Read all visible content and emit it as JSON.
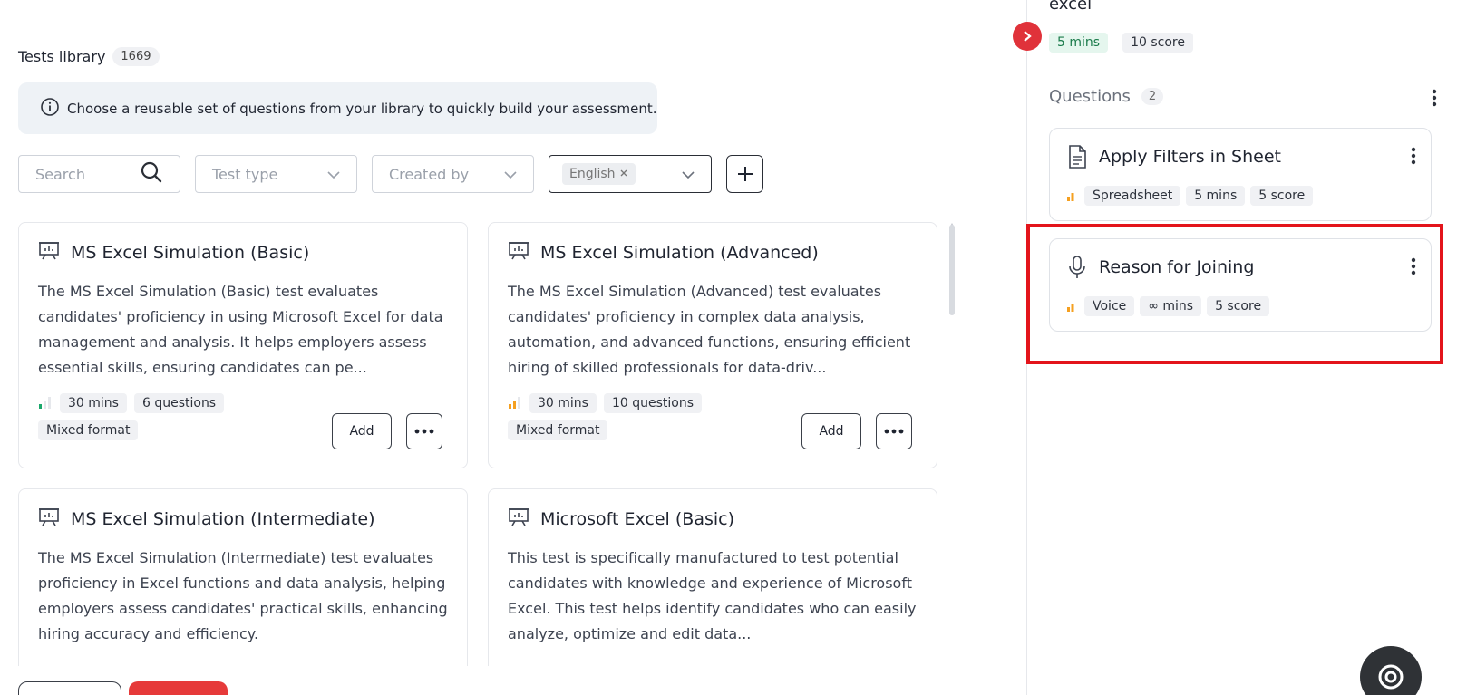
{
  "library": {
    "title": "Tests library",
    "count": "1669",
    "info": "Choose a reusable set of questions from your library to quickly build your assessment."
  },
  "filters": {
    "search_placeholder": "Search",
    "test_type": "Test type",
    "created_by": "Created by",
    "language_chip": "English"
  },
  "cards": [
    {
      "title": "MS Excel Simulation (Basic)",
      "description": "The MS Excel Simulation (Basic) test evaluates candidates' proficiency in using Microsoft Excel for data management and analysis. It helps employers assess essential skills, ensuring candidates can pe...",
      "duration": "30 mins",
      "questions": "6 questions",
      "format": "Mixed format",
      "add_label": "Add",
      "difficulty_color": "#1aa86b"
    },
    {
      "title": "MS Excel Simulation (Advanced)",
      "description": "The MS Excel Simulation (Advanced) test evaluates candidates' proficiency in complex data analysis, automation, and advanced functions, ensuring efficient hiring of skilled professionals for data-driv...",
      "duration": "30 mins",
      "questions": "10 questions",
      "format": "Mixed format",
      "add_label": "Add",
      "difficulty_color": "#f5a020"
    },
    {
      "title": "MS Excel Simulation (Intermediate)",
      "description": "The MS Excel Simulation (Intermediate) test evaluates proficiency in Excel functions and data analysis, helping employers assess candidates' practical skills, enhancing hiring accuracy and efficiency."
    },
    {
      "title": "Microsoft Excel (Basic)",
      "description": "This test is specifically manufactured to test potential candidates with knowledge and experience of Microsoft Excel. This test helps identify candidates who can easily analyze, optimize and edit data..."
    }
  ],
  "panel": {
    "title": "excel",
    "duration": "5 mins",
    "score": "10 score",
    "questions_label": "Questions",
    "questions_count": "2",
    "questions": [
      {
        "title": "Apply Filters in Sheet",
        "type": "Spreadsheet",
        "duration": "5 mins",
        "score": "5 score"
      },
      {
        "title": "Reason for Joining",
        "type": "Voice",
        "duration": "∞ mins",
        "score": "5 score"
      }
    ]
  },
  "colors": {
    "accent_red": "#e0323a",
    "highlight": "#e3141b",
    "difficulty_orange": "#f5a020",
    "difficulty_green": "#1aa86b"
  }
}
